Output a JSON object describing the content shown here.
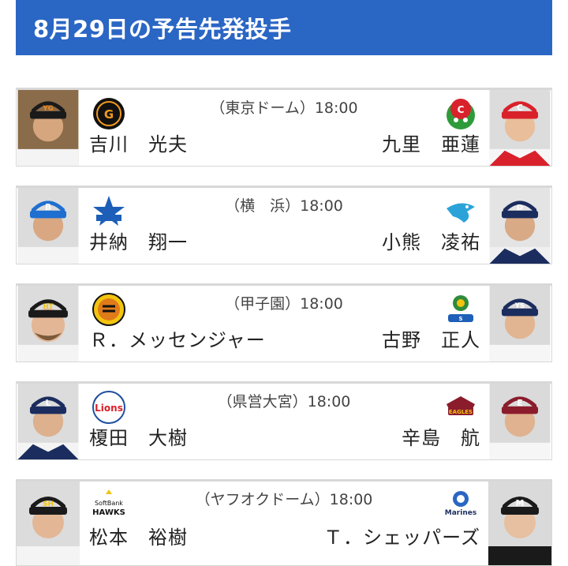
{
  "header": {
    "title": "8月29日の予告先発投手"
  },
  "games": [
    {
      "venue": "（東京ドーム）18:00",
      "home": {
        "name": "吉川　光夫",
        "team_logo": "giants-logo",
        "photo": "pitcher-photo"
      },
      "away": {
        "name": "九里　亜蓮",
        "team_logo": "carp-logo",
        "photo": "pitcher-photo"
      }
    },
    {
      "venue": "（横　浜）18:00",
      "home": {
        "name": "井納　翔一",
        "team_logo": "baystars-logo",
        "photo": "pitcher-photo"
      },
      "away": {
        "name": "小熊　凌祐",
        "team_logo": "dragons-logo",
        "photo": "pitcher-photo"
      }
    },
    {
      "venue": "（甲子園）18:00",
      "home": {
        "name": "Ｒ．メッセンジャー",
        "team_logo": "tigers-logo",
        "photo": "pitcher-photo"
      },
      "away": {
        "name": "古野　正人",
        "team_logo": "swallows-logo",
        "photo": "pitcher-photo"
      }
    },
    {
      "venue": "（県営大宮）18:00",
      "home": {
        "name": "榎田　大樹",
        "team_logo": "lions-logo",
        "photo": "pitcher-photo"
      },
      "away": {
        "name": "辛島　航",
        "team_logo": "eagles-logo",
        "photo": "pitcher-photo"
      }
    },
    {
      "venue": "（ヤフオクドーム）18:00",
      "home": {
        "name": "松本　裕樹",
        "team_logo": "hawks-logo",
        "logo_text": [
          "SoftBank",
          "HAWKS"
        ],
        "photo": "pitcher-photo"
      },
      "away": {
        "name": "Ｔ．シェッパーズ",
        "team_logo": "marines-logo",
        "logo_text": [
          "Marines"
        ],
        "photo": "pitcher-photo"
      }
    }
  ]
}
